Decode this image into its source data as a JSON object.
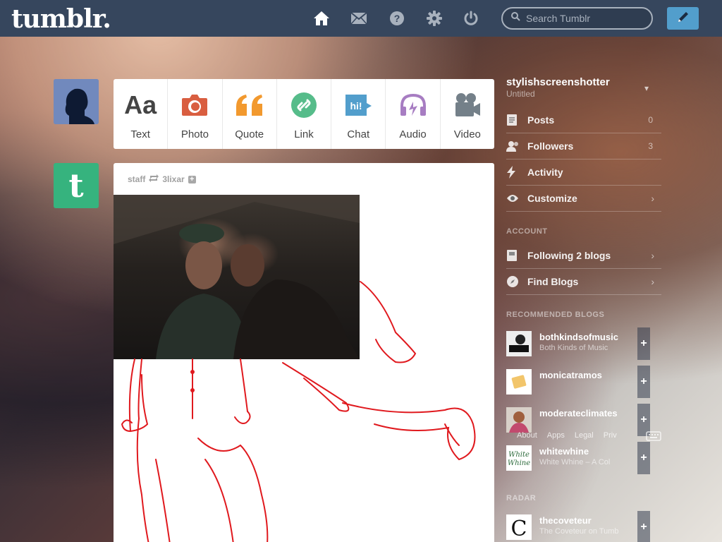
{
  "header": {
    "logo": "tumblr.",
    "search_placeholder": "Search Tumblr"
  },
  "icons": {
    "home": "home-icon",
    "inbox": "envelope-icon",
    "help": "help-icon",
    "settings": "gear-icon",
    "logout": "power-icon",
    "compose": "pencil-icon"
  },
  "post_types": [
    {
      "label": "Text",
      "icon": "Aa",
      "color": "#444444"
    },
    {
      "label": "Photo",
      "icon": "camera",
      "color": "#d95e40"
    },
    {
      "label": "Quote",
      "icon": "quote",
      "color": "#f2992e"
    },
    {
      "label": "Link",
      "icon": "link",
      "color": "#56bc8a"
    },
    {
      "label": "Chat",
      "icon": "chat",
      "color": "#529ecc"
    },
    {
      "label": "Audio",
      "icon": "headphones",
      "color": "#a77dc2"
    },
    {
      "label": "Video",
      "icon": "camera-video",
      "color": "#748089"
    }
  ],
  "post": {
    "author": "staff",
    "reblogged_from": "3lixar"
  },
  "sidebar": {
    "blog_name": "stylishscreenshotter",
    "blog_sub": "Untitled",
    "items": [
      {
        "label": "Posts",
        "count": "0"
      },
      {
        "label": "Followers",
        "count": "3"
      },
      {
        "label": "Activity"
      },
      {
        "label": "Customize"
      }
    ],
    "account_title": "ACCOUNT",
    "account_items": [
      {
        "label": "Following 2 blogs"
      },
      {
        "label": "Find Blogs"
      }
    ],
    "recommended_title": "RECOMMENDED BLOGS",
    "recommended": [
      {
        "name": "bothkindsofmusic",
        "sub": "Both Kinds of Music"
      },
      {
        "name": "monicatramos",
        "sub": ""
      },
      {
        "name": "moderateclimates",
        "sub": ""
      },
      {
        "name": "whitewhine",
        "sub": "White Whine – A Col"
      }
    ],
    "radar_title": "RADAR",
    "radar": [
      {
        "name": "thecoveteur",
        "sub": "The Coveteur on Tumb"
      }
    ]
  },
  "footer": [
    "About",
    "Apps",
    "Legal",
    "Priv"
  ],
  "colors": {
    "header_bg": "#36465d",
    "compose_bg": "#529ecc",
    "staff_avatar": "#36b37e"
  }
}
